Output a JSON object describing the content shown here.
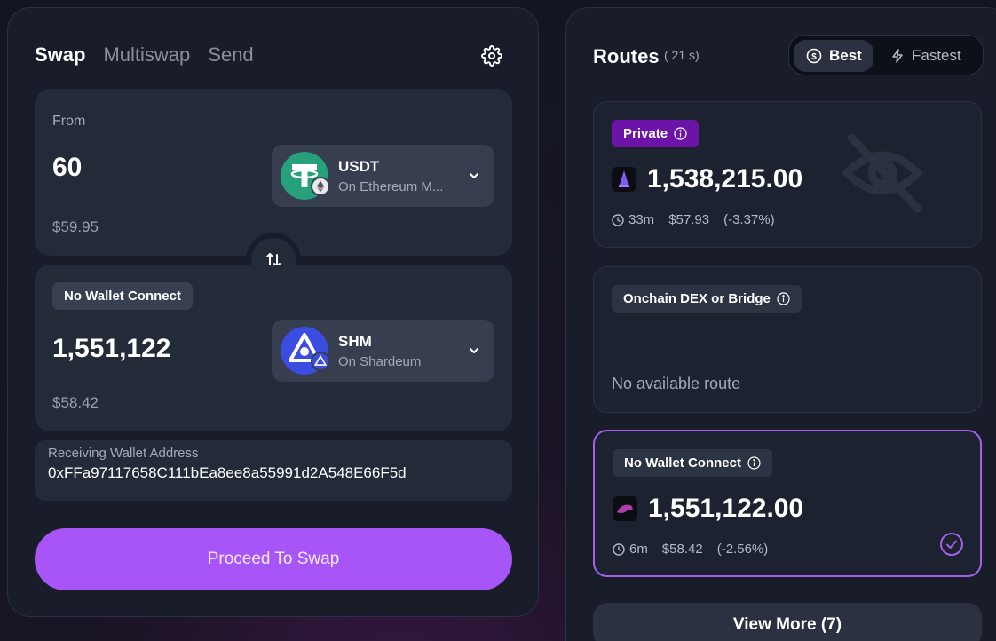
{
  "swap": {
    "tabs": [
      {
        "label": "Swap",
        "active": true
      },
      {
        "label": "Multiswap",
        "active": false
      },
      {
        "label": "Send",
        "active": false
      }
    ],
    "from": {
      "label": "From",
      "amount": "60",
      "usd": "$59.95",
      "token": {
        "symbol": "USDT",
        "chain": "On Ethereum M...",
        "logo_color": "#26a17b",
        "logo_icon": "tether-icon",
        "chain_icon": "ethereum-icon"
      }
    },
    "to": {
      "badge": "No Wallet Connect",
      "amount": "1,551,122",
      "usd": "$58.42",
      "token": {
        "symbol": "SHM",
        "chain": "On Shardeum",
        "logo_color": "#3b4ce0",
        "logo_icon": "shardeum-icon",
        "chain_icon": "shardeum-icon"
      }
    },
    "wallet": {
      "label": "Receiving Wallet Address",
      "value": "0xFFa97117658C111bEa8ee8a55991d2A548E66F5d"
    },
    "proceed_label": "Proceed To Swap",
    "accent": "#a855f7"
  },
  "routes": {
    "title": "Routes",
    "refresh": "( 21 s)",
    "sort_options": [
      {
        "label": "Best",
        "icon": "dollar-icon",
        "active": true
      },
      {
        "label": "Fastest",
        "icon": "lightning-icon",
        "active": false
      }
    ],
    "cards": [
      {
        "tag": "Private",
        "amount": "1,538,215.00",
        "time": "33m",
        "usd": "$57.93",
        "pct": "(-3.37%)"
      },
      {
        "tag": "Onchain DEX or Bridge",
        "empty_text": "No available route"
      },
      {
        "tag": "No Wallet Connect",
        "amount": "1,551,122.00",
        "time": "6m",
        "usd": "$58.42",
        "pct": "(-2.56%)",
        "selected": true
      }
    ],
    "view_more_label": "View More (7)"
  }
}
